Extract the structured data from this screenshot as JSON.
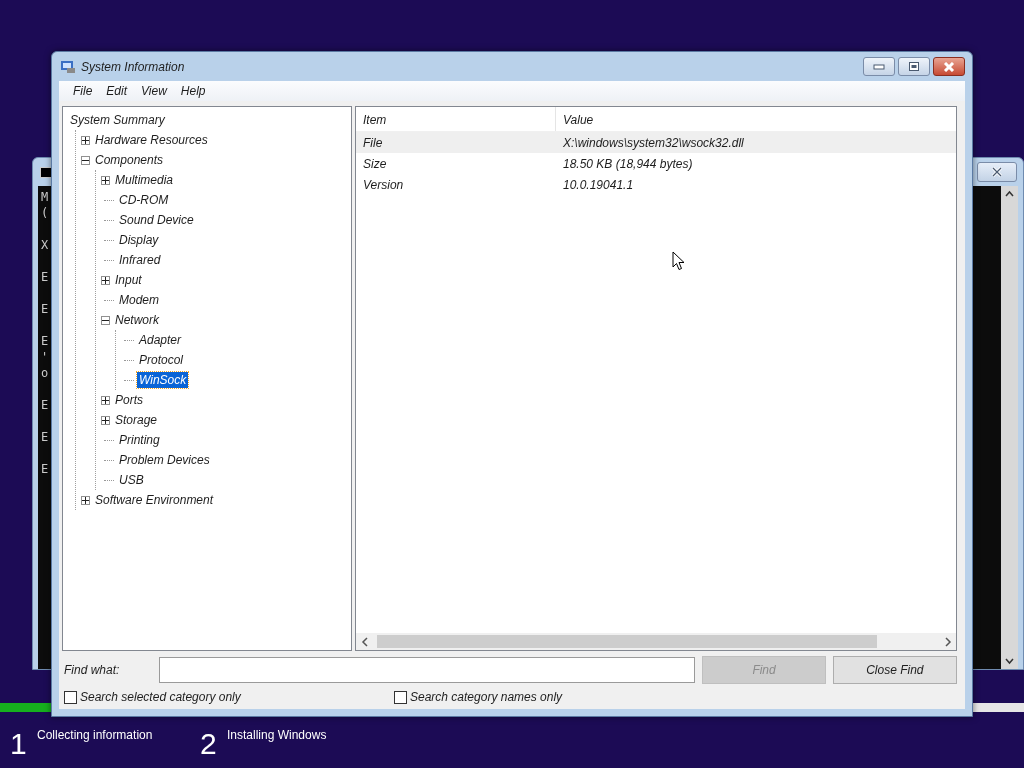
{
  "console": {
    "paragraphs": [
      [
        "M",
        "("
      ],
      [
        "X"
      ],
      [
        "E"
      ],
      [
        "E"
      ],
      [
        "E",
        "'",
        "o"
      ],
      [
        "E"
      ],
      [
        "E"
      ],
      [
        "E"
      ]
    ]
  },
  "window": {
    "title": "System Information"
  },
  "menu": [
    "File",
    "Edit",
    "View",
    "Help"
  ],
  "tree": [
    {
      "label": "System Summary",
      "kind": "root",
      "selected": false,
      "children": [
        {
          "label": "Hardware Resources",
          "kind": "group",
          "expanded": false,
          "selected": false
        },
        {
          "label": "Components",
          "kind": "group",
          "expanded": true,
          "selected": false,
          "children": [
            {
              "label": "Multimedia",
              "kind": "group",
              "expanded": false,
              "selected": false
            },
            {
              "label": "CD-ROM",
              "kind": "leaf",
              "selected": false
            },
            {
              "label": "Sound Device",
              "kind": "leaf",
              "selected": false
            },
            {
              "label": "Display",
              "kind": "leaf",
              "selected": false
            },
            {
              "label": "Infrared",
              "kind": "leaf",
              "selected": false
            },
            {
              "label": "Input",
              "kind": "group",
              "expanded": false,
              "selected": false
            },
            {
              "label": "Modem",
              "kind": "leaf",
              "selected": false
            },
            {
              "label": "Network",
              "kind": "group",
              "expanded": true,
              "selected": false,
              "children": [
                {
                  "label": "Adapter",
                  "kind": "leaf",
                  "selected": false
                },
                {
                  "label": "Protocol",
                  "kind": "leaf",
                  "selected": false
                },
                {
                  "label": "WinSock",
                  "kind": "leaf",
                  "selected": true
                }
              ]
            },
            {
              "label": "Ports",
              "kind": "group",
              "expanded": false,
              "selected": false
            },
            {
              "label": "Storage",
              "kind": "group",
              "expanded": false,
              "selected": false
            },
            {
              "label": "Printing",
              "kind": "leaf",
              "selected": false
            },
            {
              "label": "Problem Devices",
              "kind": "leaf",
              "selected": false
            },
            {
              "label": "USB",
              "kind": "leaf",
              "selected": false
            }
          ]
        },
        {
          "label": "Software Environment",
          "kind": "group",
          "expanded": false,
          "selected": false
        }
      ]
    }
  ],
  "table": {
    "columns": [
      "Item",
      "Value"
    ],
    "rows": [
      {
        "cells": [
          "File",
          "X:\\windows\\system32\\wsock32.dll"
        ],
        "selected": true
      },
      {
        "cells": [
          "Size",
          "18.50 KB (18,944 bytes)"
        ],
        "selected": false
      },
      {
        "cells": [
          "Version",
          "10.0.19041.1"
        ],
        "selected": false
      }
    ]
  },
  "find": {
    "label": "Find what:",
    "find_button": {
      "label": "Find",
      "disabled": true
    },
    "close_button": {
      "label": "Close Find",
      "disabled": false
    },
    "options": [
      {
        "label": "Search selected category only",
        "checked": false
      },
      {
        "label": "Search category names only",
        "checked": false
      }
    ]
  },
  "setup": {
    "progress": {
      "level": 0.05
    },
    "steps": [
      {
        "number": "1",
        "label": "Collecting information"
      },
      {
        "number": "2",
        "label": "Installing Windows"
      }
    ]
  }
}
